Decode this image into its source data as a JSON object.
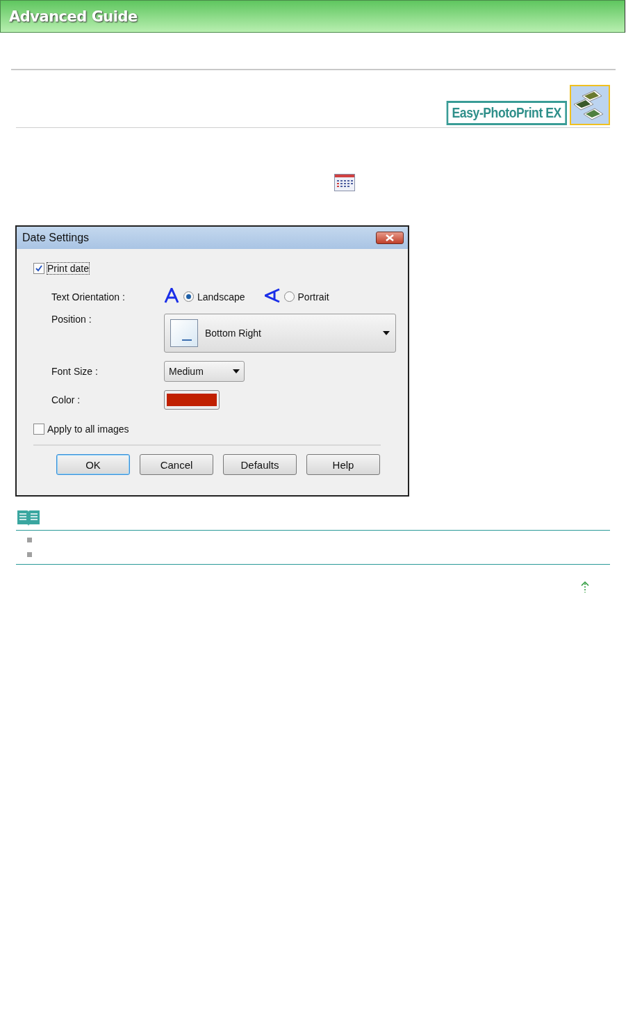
{
  "header": {
    "title": "Advanced Guide"
  },
  "product": {
    "name": "Easy-PhotoPrint EX"
  },
  "dialog": {
    "title": "Date Settings",
    "print_date": {
      "label": "Print date",
      "checked": true
    },
    "orientation": {
      "label": "Text Orientation :",
      "options": [
        {
          "label": "Landscape",
          "selected": true
        },
        {
          "label": "Portrait",
          "selected": false
        }
      ]
    },
    "position": {
      "label": "Position :",
      "value": "Bottom Right"
    },
    "font_size": {
      "label": "Font Size :",
      "value": "Medium"
    },
    "color": {
      "label": "Color :",
      "color": "#c02000"
    },
    "apply_all": {
      "label": "Apply to all images",
      "checked": false
    },
    "buttons": [
      {
        "label": "OK",
        "selected": true
      },
      {
        "label": "Cancel",
        "selected": false
      },
      {
        "label": "Defaults",
        "selected": false
      },
      {
        "label": "Help",
        "selected": false
      }
    ]
  }
}
